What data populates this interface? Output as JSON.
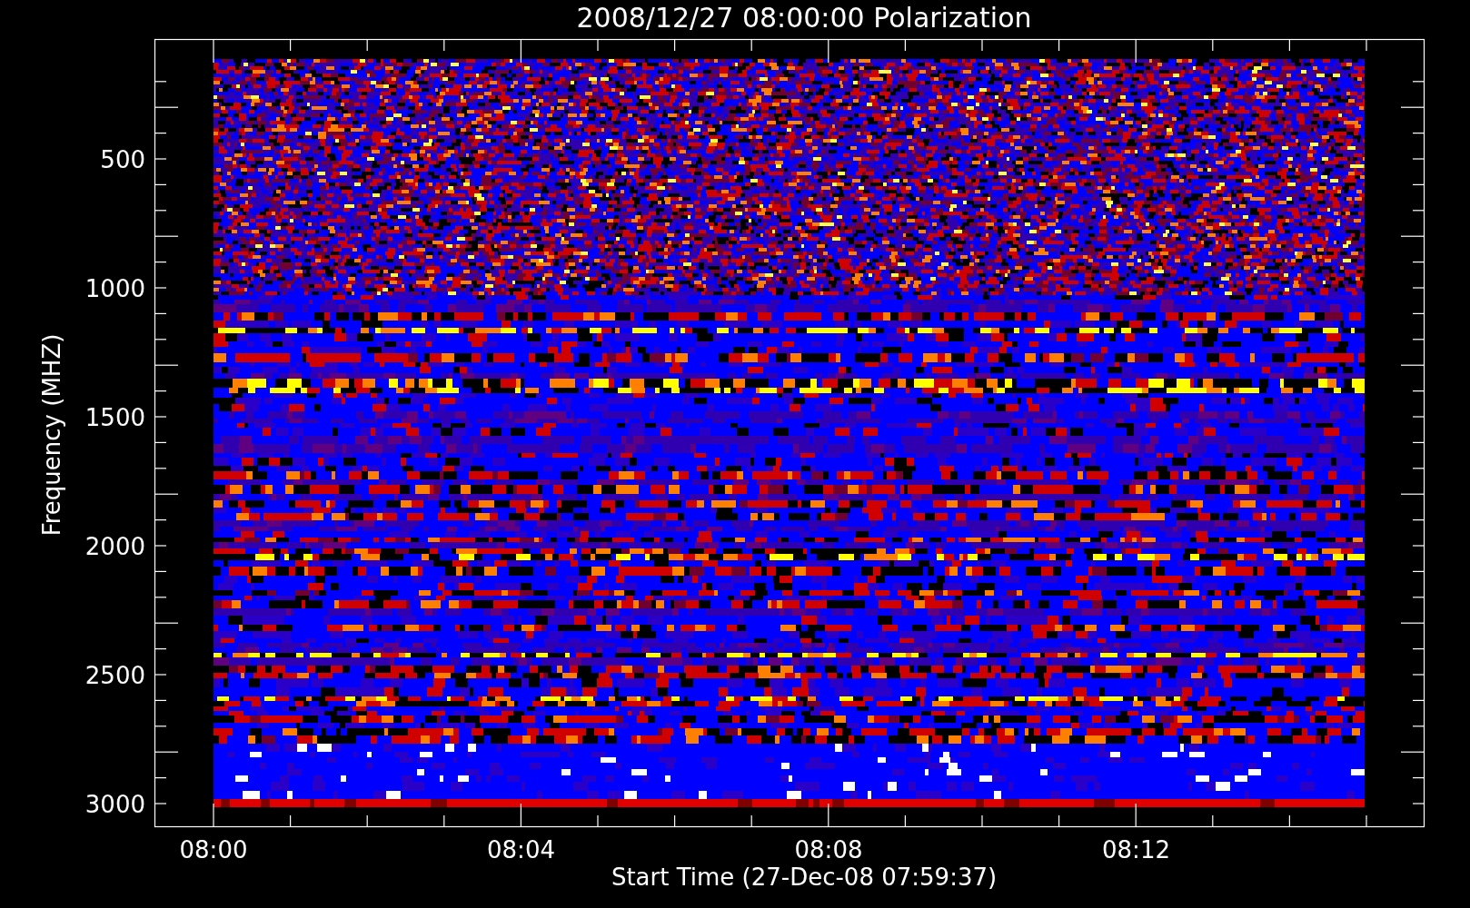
{
  "title": "2008/12/27 08:00:00 Polarization",
  "y_axis": {
    "label": "Frequency (MHZ)",
    "ticks": [
      "500",
      "1000",
      "1500",
      "2000",
      "2500",
      "3000"
    ]
  },
  "x_axis": {
    "label": "Start Time (27-Dec-08 07:59:37)",
    "ticks": [
      "08:00",
      "08:04",
      "08:08",
      "08:12"
    ]
  }
}
